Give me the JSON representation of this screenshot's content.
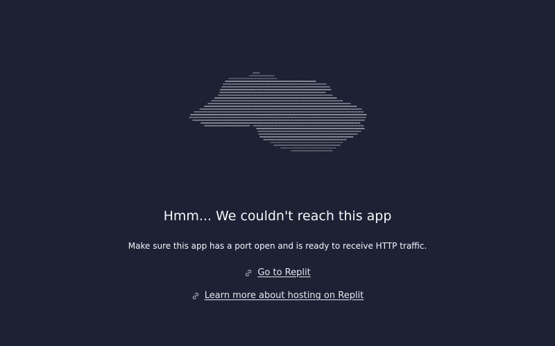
{
  "error": {
    "title": "Hmm... We couldn't reach this app",
    "message": "Make sure this app has a port open and is ready to receive HTTP traffic."
  },
  "links": [
    {
      "label": "Go to Replit",
      "icon": "link-icon"
    },
    {
      "label": "Learn more about hosting on Replit",
      "icon": "link-icon"
    }
  ],
  "colors": {
    "background": "#1c2133",
    "text": "#f5f9fc",
    "ascii_cloud": "#c2c8cc"
  }
}
